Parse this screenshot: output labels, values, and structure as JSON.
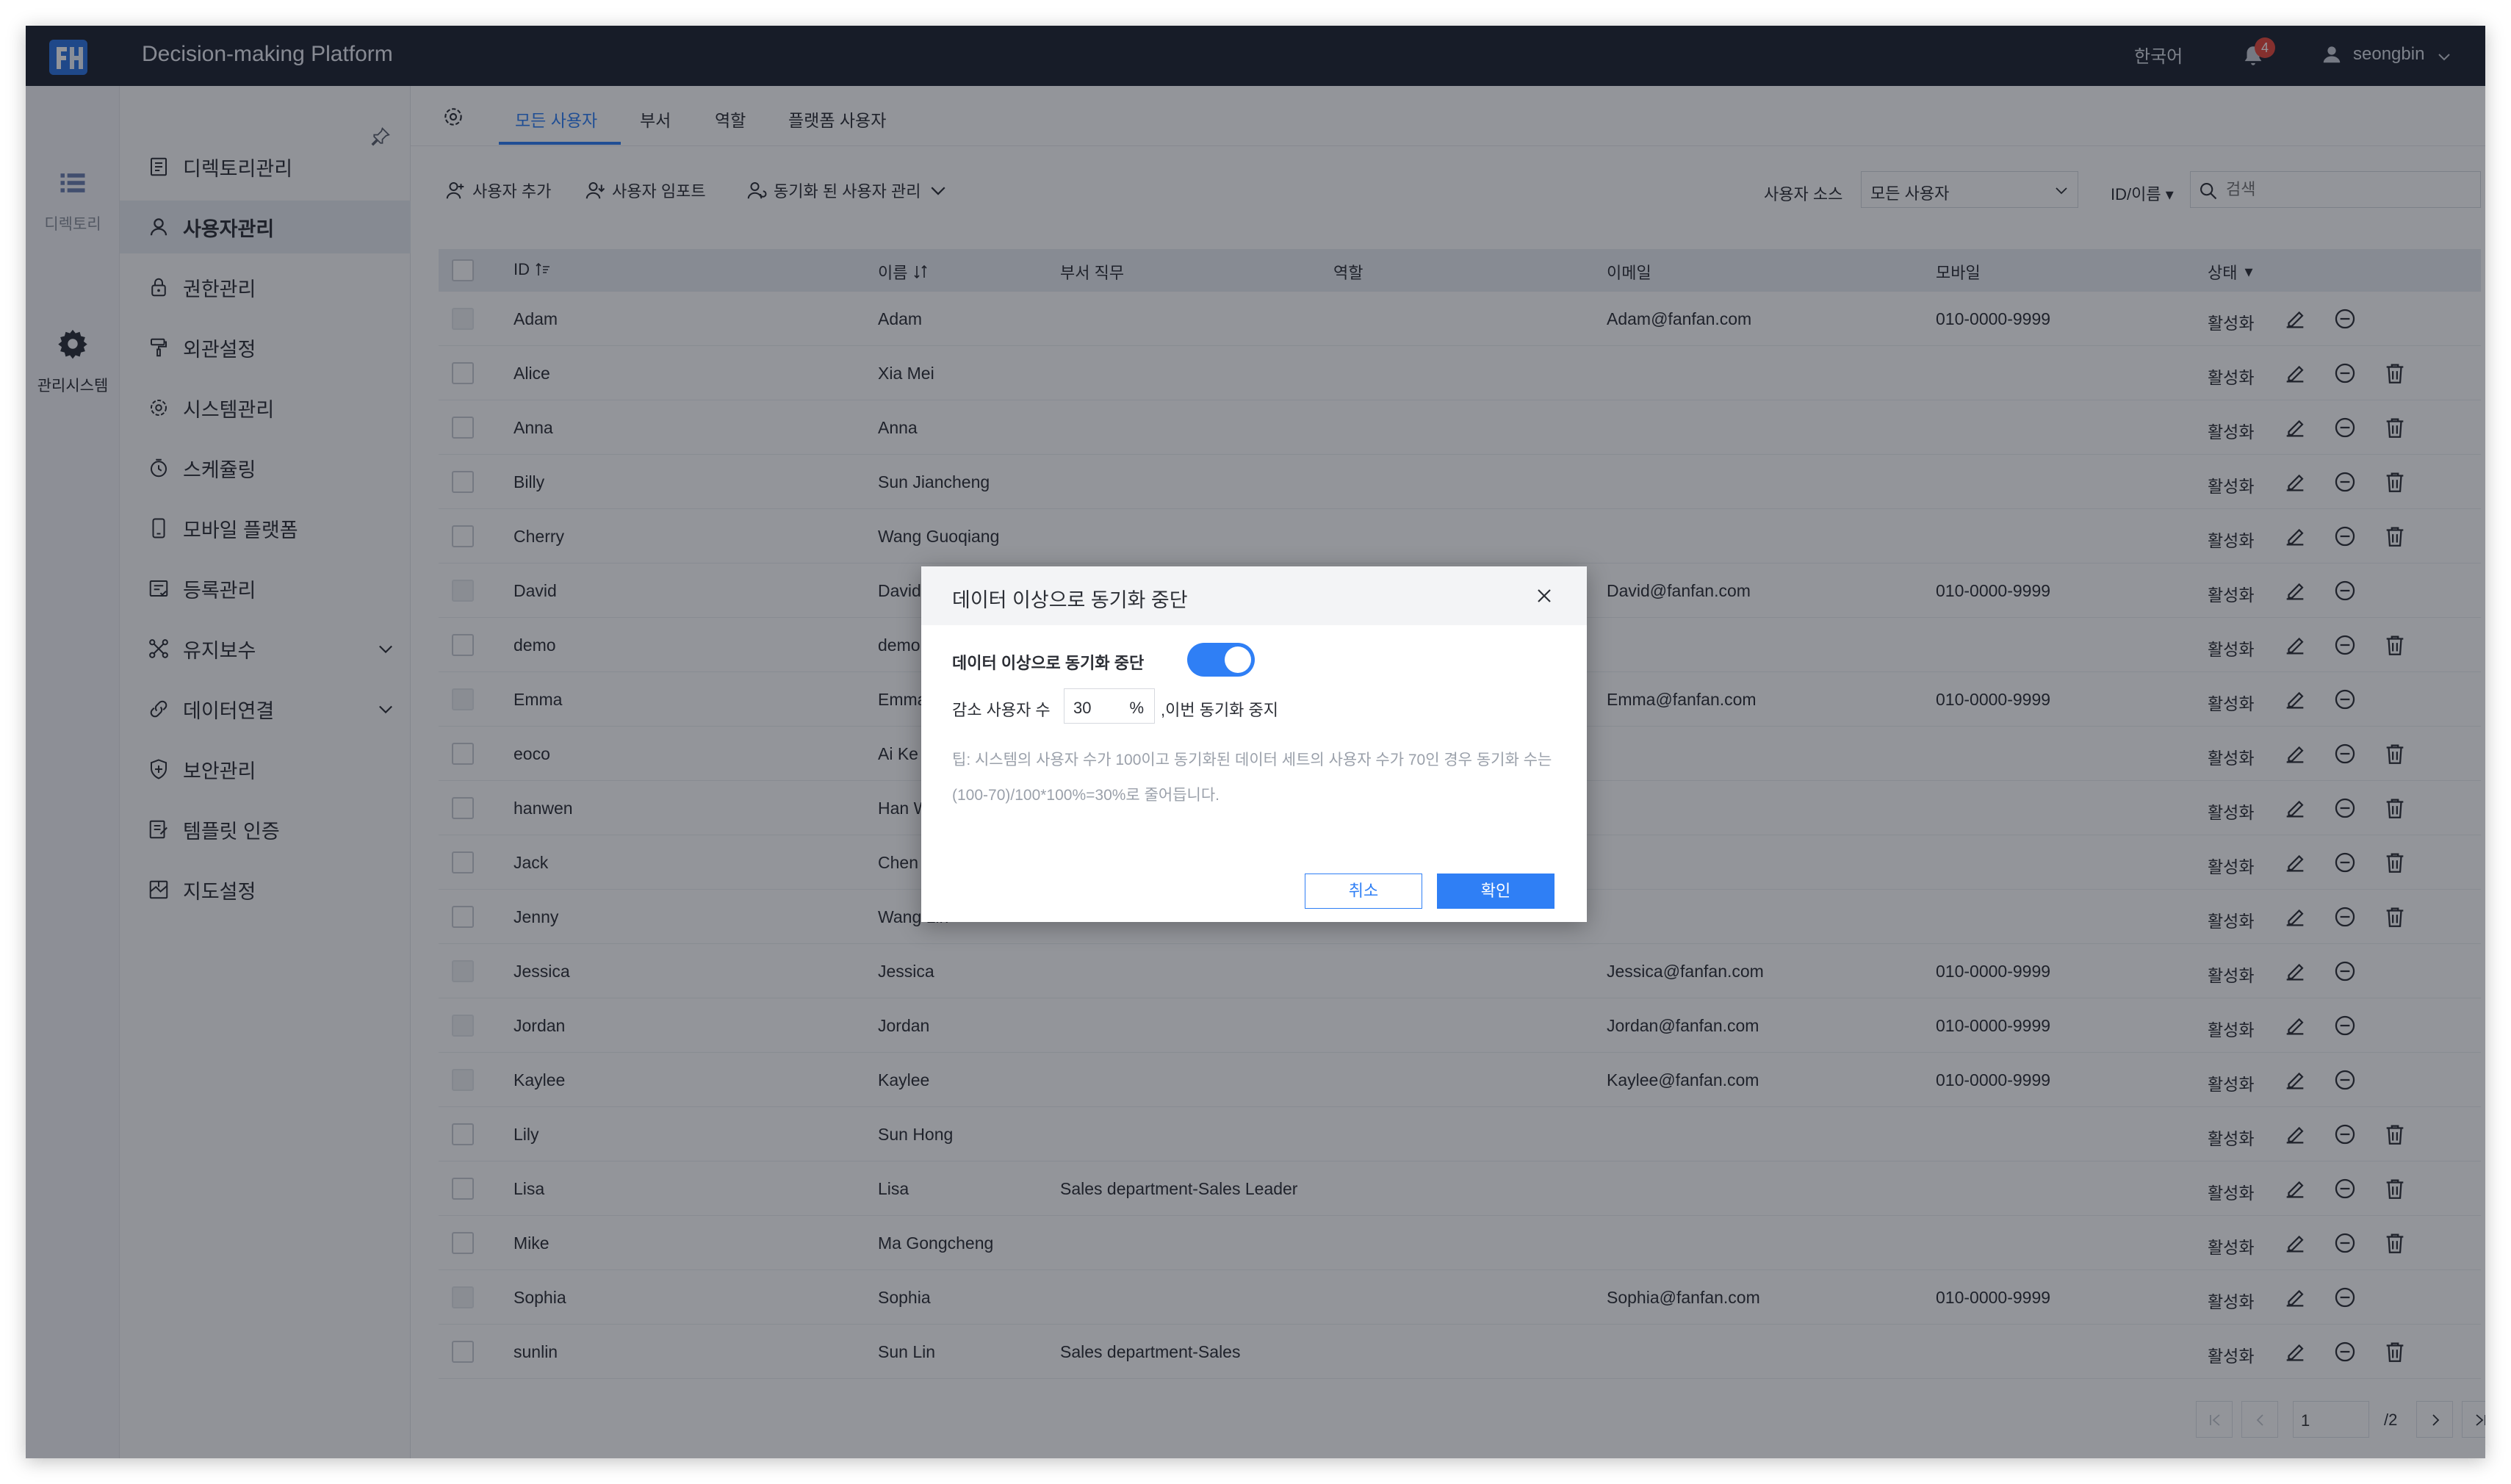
{
  "app": {
    "title": "Decision-making Platform",
    "language": "한국어",
    "notification_count": "4",
    "username": "seongbin"
  },
  "rail": [
    {
      "label": "디렉토리",
      "icon": "list-icon"
    },
    {
      "label": "관리시스템",
      "icon": "gear-icon"
    }
  ],
  "sidemenu": [
    {
      "label": "디렉토리관리",
      "icon": "directory-icon"
    },
    {
      "label": "사용자관리",
      "icon": "user-icon",
      "active": true
    },
    {
      "label": "권한관리",
      "icon": "lock-icon"
    },
    {
      "label": "외관설정",
      "icon": "paint-roller-icon"
    },
    {
      "label": "시스템관리",
      "icon": "settings-icon"
    },
    {
      "label": "스케쥴링",
      "icon": "timer-icon"
    },
    {
      "label": "모바일 플랫폼",
      "icon": "mobile-icon"
    },
    {
      "label": "등록관리",
      "icon": "register-icon"
    },
    {
      "label": "유지보수",
      "icon": "maintenance-icon",
      "expandable": true
    },
    {
      "label": "데이터연결",
      "icon": "link-icon",
      "expandable": true
    },
    {
      "label": "보안관리",
      "icon": "shield-icon"
    },
    {
      "label": "템플릿 인증",
      "icon": "template-icon"
    },
    {
      "label": "지도설정",
      "icon": "map-icon"
    }
  ],
  "tabs": [
    "모든 사용자",
    "부서",
    "역할",
    "플랫폼 사용자"
  ],
  "toolbar": {
    "add_user": "사용자 추가",
    "import_user": "사용자 임포트",
    "sync_manage": "동기화 된 사용자 관리",
    "source_label": "사용자 소스",
    "source_value": "모든 사용자",
    "id_name_select": "ID/이름",
    "search_placeholder": "검색"
  },
  "table": {
    "headers": {
      "id": "ID",
      "name": "이름",
      "dept_role": "부서 직무",
      "role": "역할",
      "email": "이메일",
      "mobile": "모바일",
      "status": "상태"
    },
    "rows": [
      {
        "id": "Adam",
        "name": "Adam",
        "dept": "",
        "email": "Adam@fanfan.com",
        "mobile": "010-0000-9999",
        "status": "활성화",
        "disabled": true,
        "deletable": false
      },
      {
        "id": "Alice",
        "name": "Xia Mei",
        "dept": "",
        "email": "",
        "mobile": "",
        "status": "활성화",
        "disabled": false,
        "deletable": true
      },
      {
        "id": "Anna",
        "name": "Anna",
        "dept": "",
        "email": "",
        "mobile": "",
        "status": "활성화",
        "disabled": false,
        "deletable": true
      },
      {
        "id": "Billy",
        "name": "Sun Jiancheng",
        "dept": "",
        "email": "",
        "mobile": "",
        "status": "활성화",
        "disabled": false,
        "deletable": true
      },
      {
        "id": "Cherry",
        "name": "Wang Guoqiang",
        "dept": "",
        "email": "",
        "mobile": "",
        "status": "활성화",
        "disabled": false,
        "deletable": true
      },
      {
        "id": "David",
        "name": "David",
        "dept": "",
        "email": "David@fanfan.com",
        "mobile": "010-0000-9999",
        "status": "활성화",
        "disabled": true,
        "deletable": false
      },
      {
        "id": "demo",
        "name": "demo",
        "dept": "",
        "email": "",
        "mobile": "",
        "status": "활성화",
        "disabled": false,
        "deletable": true
      },
      {
        "id": "Emma",
        "name": "Emma",
        "dept": "",
        "email": "Emma@fanfan.com",
        "mobile": "010-0000-9999",
        "status": "활성화",
        "disabled": true,
        "deletable": false
      },
      {
        "id": "eoco",
        "name": "Ai Ke",
        "dept": "",
        "email": "",
        "mobile": "",
        "status": "활성화",
        "disabled": false,
        "deletable": true
      },
      {
        "id": "hanwen",
        "name": "Han Wen",
        "dept": "",
        "email": "",
        "mobile": "",
        "status": "활성화",
        "disabled": false,
        "deletable": true
      },
      {
        "id": "Jack",
        "name": "Chen Bin",
        "dept": "",
        "email": "",
        "mobile": "",
        "status": "활성화",
        "disabled": false,
        "deletable": true
      },
      {
        "id": "Jenny",
        "name": "Wang Lin",
        "dept": "",
        "email": "",
        "mobile": "",
        "status": "활성화",
        "disabled": false,
        "deletable": true
      },
      {
        "id": "Jessica",
        "name": "Jessica",
        "dept": "",
        "email": "Jessica@fanfan.com",
        "mobile": "010-0000-9999",
        "status": "활성화",
        "disabled": true,
        "deletable": false
      },
      {
        "id": "Jordan",
        "name": "Jordan",
        "dept": "",
        "email": "Jordan@fanfan.com",
        "mobile": "010-0000-9999",
        "status": "활성화",
        "disabled": true,
        "deletable": false
      },
      {
        "id": "Kaylee",
        "name": "Kaylee",
        "dept": "",
        "email": "Kaylee@fanfan.com",
        "mobile": "010-0000-9999",
        "status": "활성화",
        "disabled": true,
        "deletable": false
      },
      {
        "id": "Lily",
        "name": "Sun Hong",
        "dept": "",
        "email": "",
        "mobile": "",
        "status": "활성화",
        "disabled": false,
        "deletable": true
      },
      {
        "id": "Lisa",
        "name": "Lisa",
        "dept": "Sales department-Sales Leader",
        "email": "",
        "mobile": "",
        "status": "활성화",
        "disabled": false,
        "deletable": true
      },
      {
        "id": "Mike",
        "name": "Ma Gongcheng",
        "dept": "",
        "email": "",
        "mobile": "",
        "status": "활성화",
        "disabled": false,
        "deletable": true
      },
      {
        "id": "Sophia",
        "name": "Sophia",
        "dept": "",
        "email": "Sophia@fanfan.com",
        "mobile": "010-0000-9999",
        "status": "활성화",
        "disabled": true,
        "deletable": false
      },
      {
        "id": "sunlin",
        "name": "Sun Lin",
        "dept": "Sales department-Sales",
        "email": "",
        "mobile": "",
        "status": "활성화",
        "disabled": false,
        "deletable": true
      }
    ]
  },
  "pagination": {
    "current": "1",
    "total": "/2"
  },
  "dialog": {
    "title": "데이터 이상으로 동기화 중단",
    "toggle_label": "데이터 이상으로 동기화 중단",
    "toggle_on": true,
    "reduce_label": "감소 사용자 수",
    "reduce_value": "30",
    "reduce_unit": "%",
    "reduce_suffix": ",이번 동기화 중지",
    "tip": "팁: 시스템의 사용자 수가 100이고 동기화된 데이터 세트의 사용자 수가 70인 경우 동기화 수는 (100-70)/100*100%=30%로 줄어듭니다.",
    "cancel": "취소",
    "confirm": "확인"
  },
  "colors": {
    "accent": "#2f7ff5",
    "topbar": "#1e2330",
    "badge": "#e5483b"
  }
}
